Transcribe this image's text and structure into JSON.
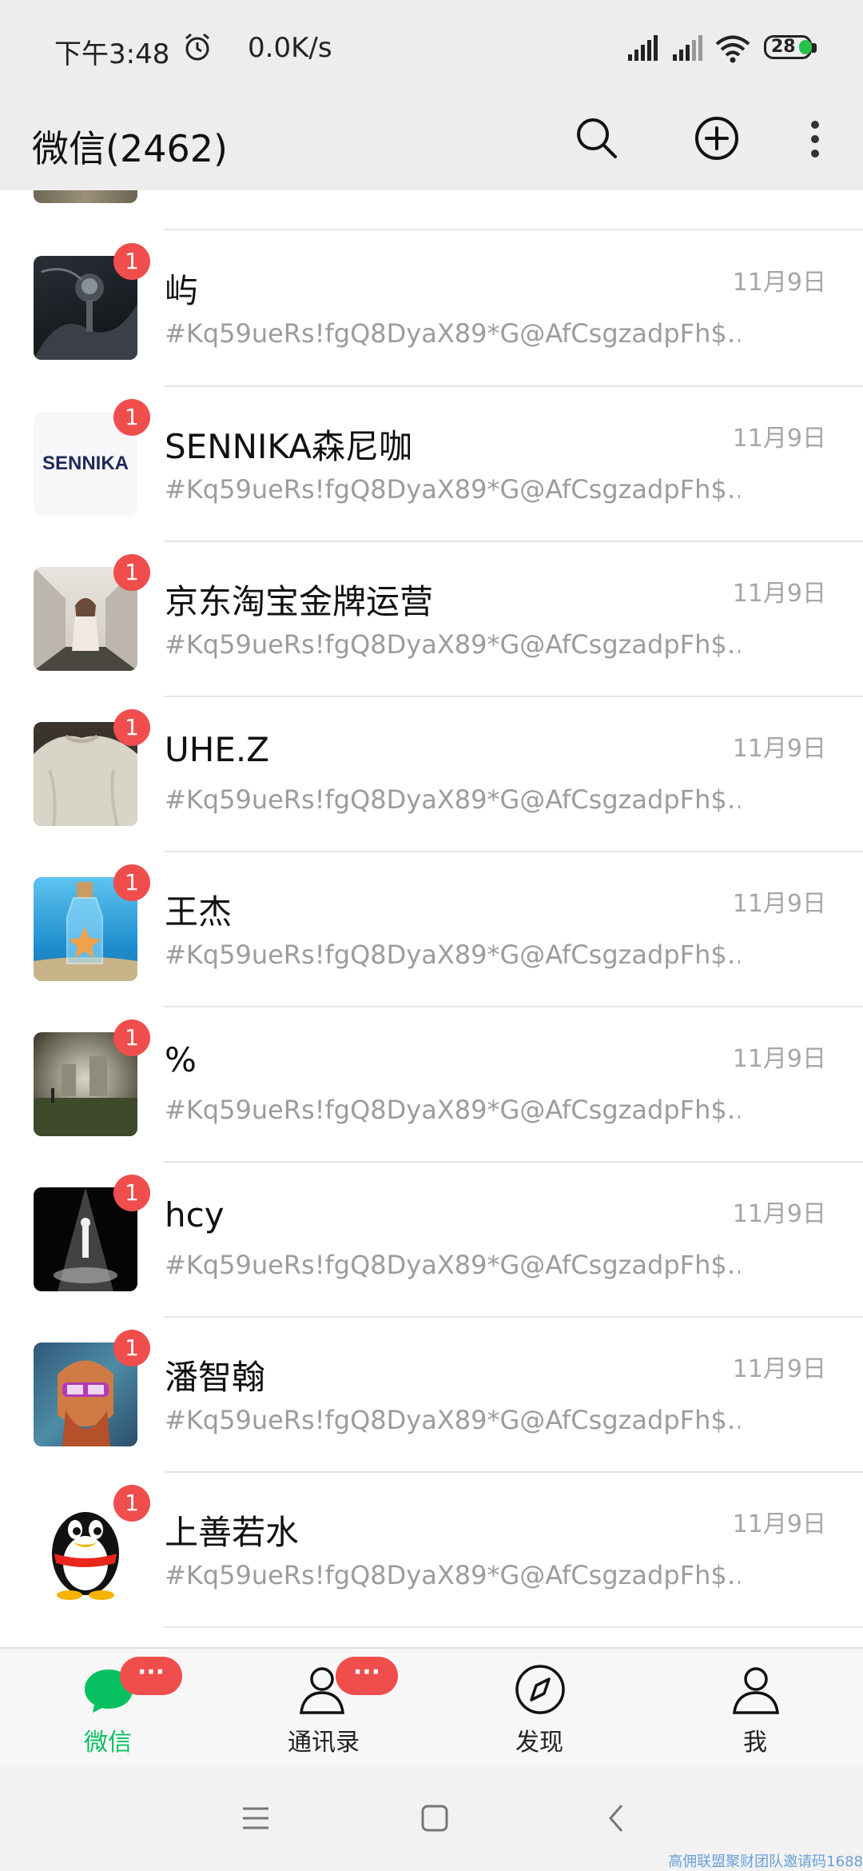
{
  "status_bar": {
    "time": "下午3:48",
    "net_speed": "0.0K/s",
    "battery": "28",
    "battery_color": "#27c24c"
  },
  "header": {
    "title": "微信(2462)",
    "icons": [
      "search-icon",
      "add-circle-icon",
      "more-vertical-icon"
    ]
  },
  "chats": [
    {
      "name": "屿",
      "message": "#Kq59ueRs!fgQ8DyaX89*G@AfCsgzadpFh$…",
      "date": "11月9日",
      "unread": "1",
      "avatar": "car-gearshift"
    },
    {
      "name": "SENNIKA森尼咖",
      "message": "#Kq59ueRs!fgQ8DyaX89*G@AfCsgzadpFh$…",
      "date": "11月9日",
      "unread": "1",
      "avatar": "sennika-logo",
      "avatar_text": "SENNIKA"
    },
    {
      "name": "京东淘宝金牌运营",
      "message": "#Kq59ueRs!fgQ8DyaX89*G@AfCsgzadpFh$…",
      "date": "11月9日",
      "unread": "1",
      "avatar": "girl-in-hallway"
    },
    {
      "name": "UHE.Z",
      "message": "#Kq59ueRs!fgQ8DyaX89*G@AfCsgzadpFh$…",
      "date": "11月9日",
      "unread": "1",
      "avatar": "sweater"
    },
    {
      "name": "王杰",
      "message": "#Kq59ueRs!fgQ8DyaX89*G@AfCsgzadpFh$…",
      "date": "11月9日",
      "unread": "1",
      "avatar": "starfish-bottle"
    },
    {
      "name": "%",
      "message": "#Kq59ueRs!fgQ8DyaX89*G@AfCsgzadpFh$…",
      "date": "11月9日",
      "unread": "1",
      "avatar": "city-field"
    },
    {
      "name": "hcy",
      "message": "#Kq59ueRs!fgQ8DyaX89*G@AfCsgzadpFh$…",
      "date": "11月9日",
      "unread": "1",
      "avatar": "spotlight-figure"
    },
    {
      "name": "潘智翰",
      "message": "#Kq59ueRs!fgQ8DyaX89*G@AfCsgzadpFh$…",
      "date": "11月9日",
      "unread": "1",
      "avatar": "van-gogh-glasses"
    },
    {
      "name": "上善若水",
      "message": "#Kq59ueRs!fgQ8DyaX89*G@AfCsgzadpFh$…",
      "date": "11月9日",
      "unread": "1",
      "avatar": "qq-penguin"
    }
  ],
  "tabs": [
    {
      "label": "微信",
      "badge": "···",
      "active": true,
      "icon": "chat-bubble-icon"
    },
    {
      "label": "通讯录",
      "badge": "···",
      "active": false,
      "icon": "contacts-icon"
    },
    {
      "label": "发现",
      "badge": "",
      "active": false,
      "icon": "compass-icon"
    },
    {
      "label": "我",
      "badge": "",
      "active": false,
      "icon": "person-icon"
    }
  ],
  "colors": {
    "accent_green": "#07c160",
    "badge_red": "#f04d4d",
    "bar_bg": "#ededed"
  },
  "watermark": "高佣联盟聚财团队邀请码1688"
}
